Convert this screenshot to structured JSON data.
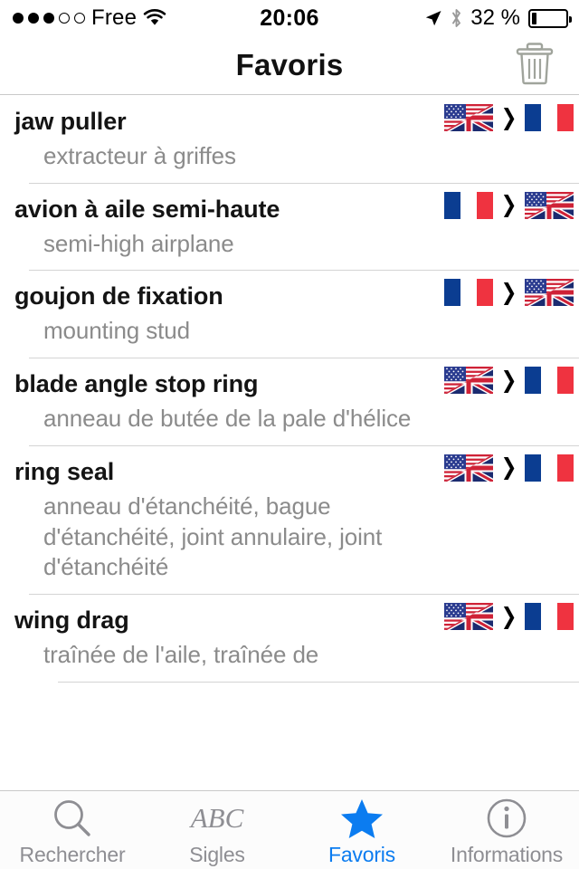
{
  "status_bar": {
    "signal_dots_filled": 3,
    "signal_dots_total": 5,
    "carrier": "Free",
    "wifi_icon": "wifi-icon",
    "time": "20:06",
    "location_icon": "location-arrow-icon",
    "bluetooth_icon": "bluetooth-icon",
    "battery_percent_label": "32 %",
    "battery_level": 32
  },
  "nav_bar": {
    "title": "Favoris",
    "trash_icon": "trash-icon",
    "trash_color": "#a0a49c"
  },
  "colors": {
    "accent_blue": "#0b7cf0",
    "term_text": "#141414",
    "translation_text": "#8b8b8b",
    "separator": "#d4d4d4",
    "tab_inactive": "#8e8e93",
    "flag_blue": "#0b3d91",
    "flag_red": "#ef3340"
  },
  "list": {
    "entries": [
      {
        "term": "jaw puller",
        "translation": "extracteur à griffes",
        "direction": "en-to-fr",
        "source_flag": "us-uk-flag-icon",
        "target_flag": "fr-flag-icon",
        "arrow": "❯"
      },
      {
        "term": "avion à aile semi-haute",
        "translation": "semi-high airplane",
        "direction": "fr-to-en",
        "source_flag": "fr-flag-icon",
        "target_flag": "us-uk-flag-icon",
        "arrow": "❯"
      },
      {
        "term": "goujon de fixation",
        "translation": "mounting stud",
        "direction": "fr-to-en",
        "source_flag": "fr-flag-icon",
        "target_flag": "us-uk-flag-icon",
        "arrow": "❯"
      },
      {
        "term": "blade angle stop ring",
        "translation": "anneau de butée de la pale d'hélice",
        "direction": "en-to-fr",
        "source_flag": "us-uk-flag-icon",
        "target_flag": "fr-flag-icon",
        "arrow": "❯"
      },
      {
        "term": "ring seal",
        "translation": "anneau d'étanchéité, bague d'étanchéité, joint annulaire, joint d'étanchéité",
        "direction": "en-to-fr",
        "source_flag": "us-uk-flag-icon",
        "target_flag": "fr-flag-icon",
        "arrow": "❯"
      },
      {
        "term": "wing drag",
        "translation": "traînée de l'aile, traînée de",
        "direction": "en-to-fr",
        "source_flag": "us-uk-flag-icon",
        "target_flag": "fr-flag-icon",
        "arrow": "❯"
      }
    ]
  },
  "tab_bar": {
    "tabs": [
      {
        "label": "Rechercher",
        "icon": "search-icon",
        "active": false
      },
      {
        "label": "Sigles",
        "icon": "abc-icon",
        "icon_text": "ABC",
        "active": false
      },
      {
        "label": "Favoris",
        "icon": "star-icon",
        "active": true
      },
      {
        "label": "Informations",
        "icon": "info-circle-icon",
        "active": false
      }
    ]
  }
}
